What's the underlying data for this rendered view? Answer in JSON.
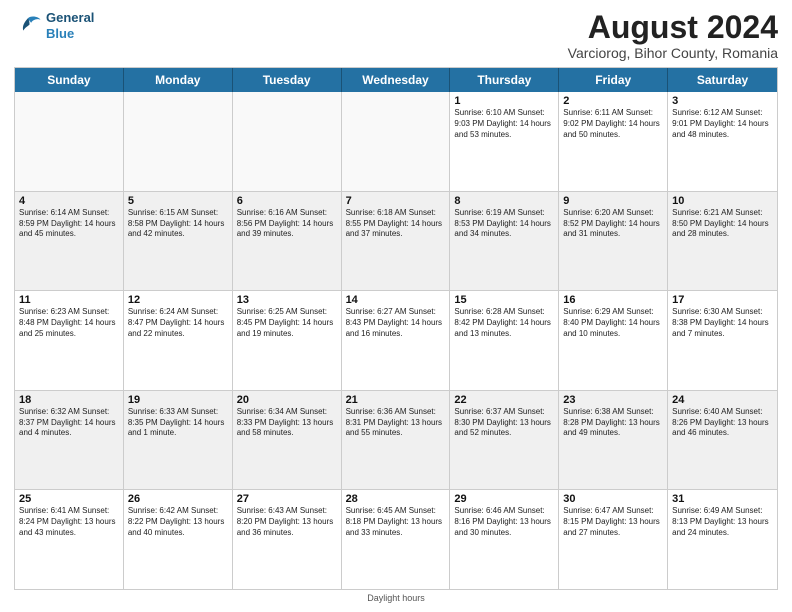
{
  "header": {
    "logo_line1": "General",
    "logo_line2": "Blue",
    "title": "August 2024",
    "subtitle": "Varciorog, Bihor County, Romania"
  },
  "days_of_week": [
    "Sunday",
    "Monday",
    "Tuesday",
    "Wednesday",
    "Thursday",
    "Friday",
    "Saturday"
  ],
  "footer": "Daylight hours",
  "weeks": [
    [
      {
        "day": "",
        "info": "",
        "empty": true
      },
      {
        "day": "",
        "info": "",
        "empty": true
      },
      {
        "day": "",
        "info": "",
        "empty": true
      },
      {
        "day": "",
        "info": "",
        "empty": true
      },
      {
        "day": "1",
        "info": "Sunrise: 6:10 AM\nSunset: 9:03 PM\nDaylight: 14 hours\nand 53 minutes."
      },
      {
        "day": "2",
        "info": "Sunrise: 6:11 AM\nSunset: 9:02 PM\nDaylight: 14 hours\nand 50 minutes."
      },
      {
        "day": "3",
        "info": "Sunrise: 6:12 AM\nSunset: 9:01 PM\nDaylight: 14 hours\nand 48 minutes."
      }
    ],
    [
      {
        "day": "4",
        "info": "Sunrise: 6:14 AM\nSunset: 8:59 PM\nDaylight: 14 hours\nand 45 minutes."
      },
      {
        "day": "5",
        "info": "Sunrise: 6:15 AM\nSunset: 8:58 PM\nDaylight: 14 hours\nand 42 minutes."
      },
      {
        "day": "6",
        "info": "Sunrise: 6:16 AM\nSunset: 8:56 PM\nDaylight: 14 hours\nand 39 minutes."
      },
      {
        "day": "7",
        "info": "Sunrise: 6:18 AM\nSunset: 8:55 PM\nDaylight: 14 hours\nand 37 minutes."
      },
      {
        "day": "8",
        "info": "Sunrise: 6:19 AM\nSunset: 8:53 PM\nDaylight: 14 hours\nand 34 minutes."
      },
      {
        "day": "9",
        "info": "Sunrise: 6:20 AM\nSunset: 8:52 PM\nDaylight: 14 hours\nand 31 minutes."
      },
      {
        "day": "10",
        "info": "Sunrise: 6:21 AM\nSunset: 8:50 PM\nDaylight: 14 hours\nand 28 minutes."
      }
    ],
    [
      {
        "day": "11",
        "info": "Sunrise: 6:23 AM\nSunset: 8:48 PM\nDaylight: 14 hours\nand 25 minutes."
      },
      {
        "day": "12",
        "info": "Sunrise: 6:24 AM\nSunset: 8:47 PM\nDaylight: 14 hours\nand 22 minutes."
      },
      {
        "day": "13",
        "info": "Sunrise: 6:25 AM\nSunset: 8:45 PM\nDaylight: 14 hours\nand 19 minutes."
      },
      {
        "day": "14",
        "info": "Sunrise: 6:27 AM\nSunset: 8:43 PM\nDaylight: 14 hours\nand 16 minutes."
      },
      {
        "day": "15",
        "info": "Sunrise: 6:28 AM\nSunset: 8:42 PM\nDaylight: 14 hours\nand 13 minutes."
      },
      {
        "day": "16",
        "info": "Sunrise: 6:29 AM\nSunset: 8:40 PM\nDaylight: 14 hours\nand 10 minutes."
      },
      {
        "day": "17",
        "info": "Sunrise: 6:30 AM\nSunset: 8:38 PM\nDaylight: 14 hours\nand 7 minutes."
      }
    ],
    [
      {
        "day": "18",
        "info": "Sunrise: 6:32 AM\nSunset: 8:37 PM\nDaylight: 14 hours\nand 4 minutes."
      },
      {
        "day": "19",
        "info": "Sunrise: 6:33 AM\nSunset: 8:35 PM\nDaylight: 14 hours\nand 1 minute."
      },
      {
        "day": "20",
        "info": "Sunrise: 6:34 AM\nSunset: 8:33 PM\nDaylight: 13 hours\nand 58 minutes."
      },
      {
        "day": "21",
        "info": "Sunrise: 6:36 AM\nSunset: 8:31 PM\nDaylight: 13 hours\nand 55 minutes."
      },
      {
        "day": "22",
        "info": "Sunrise: 6:37 AM\nSunset: 8:30 PM\nDaylight: 13 hours\nand 52 minutes."
      },
      {
        "day": "23",
        "info": "Sunrise: 6:38 AM\nSunset: 8:28 PM\nDaylight: 13 hours\nand 49 minutes."
      },
      {
        "day": "24",
        "info": "Sunrise: 6:40 AM\nSunset: 8:26 PM\nDaylight: 13 hours\nand 46 minutes."
      }
    ],
    [
      {
        "day": "25",
        "info": "Sunrise: 6:41 AM\nSunset: 8:24 PM\nDaylight: 13 hours\nand 43 minutes."
      },
      {
        "day": "26",
        "info": "Sunrise: 6:42 AM\nSunset: 8:22 PM\nDaylight: 13 hours\nand 40 minutes."
      },
      {
        "day": "27",
        "info": "Sunrise: 6:43 AM\nSunset: 8:20 PM\nDaylight: 13 hours\nand 36 minutes."
      },
      {
        "day": "28",
        "info": "Sunrise: 6:45 AM\nSunset: 8:18 PM\nDaylight: 13 hours\nand 33 minutes."
      },
      {
        "day": "29",
        "info": "Sunrise: 6:46 AM\nSunset: 8:16 PM\nDaylight: 13 hours\nand 30 minutes."
      },
      {
        "day": "30",
        "info": "Sunrise: 6:47 AM\nSunset: 8:15 PM\nDaylight: 13 hours\nand 27 minutes."
      },
      {
        "day": "31",
        "info": "Sunrise: 6:49 AM\nSunset: 8:13 PM\nDaylight: 13 hours\nand 24 minutes."
      }
    ]
  ]
}
